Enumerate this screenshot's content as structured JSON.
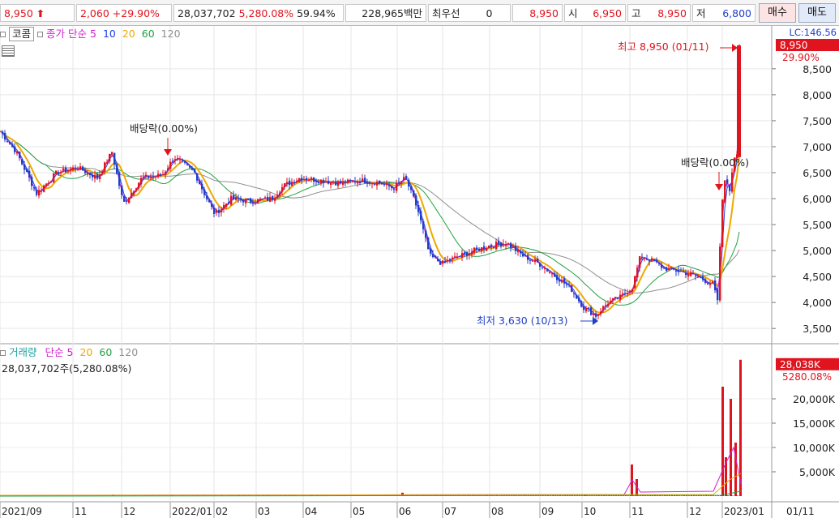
{
  "quote_bar": {
    "price": "8,950",
    "change": "2,060",
    "change_rate": "+29.90%",
    "volume": "28,037,702",
    "volume_rate": "5,280.08%",
    "turnover": "59.94%",
    "trade_value": "228,965백만",
    "best_quote_label": "최우선",
    "best_quote_value": "0",
    "current_price": "8,950",
    "open_label": "시",
    "open_value": "6,950",
    "high_label": "고",
    "high_value": "8,950",
    "low_label": "저",
    "low_value": "6,800",
    "buy_label": "매수",
    "sell_label": "매도",
    "colors": {
      "up": "#e0141e",
      "down": "#1f3fc8"
    }
  },
  "price_legend": {
    "name": "코콤",
    "indicator": "종가 단순",
    "periods": [
      "5",
      "10",
      "20",
      "60",
      "120"
    ],
    "colors": [
      "#d020d0",
      "#2040e0",
      "#f0a800",
      "#20a040",
      "#909090"
    ]
  },
  "volume_legend": {
    "name": "거래량",
    "indicator": "단순",
    "periods": [
      "5",
      "20",
      "60",
      "120"
    ],
    "colors": [
      "#d020d0",
      "#f0a800",
      "#20a040",
      "#909090"
    ],
    "summary": "28,037,702주(5,280.08%)"
  },
  "chart_data": {
    "type": "candlestick",
    "title": "코콤",
    "x_tick_labels": [
      "2021/09",
      "11",
      "12",
      "2022/01",
      "02",
      "03",
      "04",
      "05",
      "06",
      "07",
      "08",
      "09",
      "10",
      "11",
      "12",
      "2023/01",
      "01/11"
    ],
    "price_axis": {
      "tick_labels": [
        "3,500",
        "4,000",
        "4,500",
        "5,000",
        "5,500",
        "6,000",
        "6,500",
        "7,000",
        "7,500",
        "8,000",
        "8,500"
      ],
      "ylim": [
        3300,
        9200
      ],
      "top_label": "LC:146.56",
      "current_label": "8,950",
      "current_rate_label": "29.90%"
    },
    "volume_axis": {
      "tick_labels": [
        "5,000K",
        "10,000K",
        "15,000K",
        "20,000K"
      ],
      "ylim": [
        0,
        30000
      ],
      "current_label": "28,038K",
      "current_rate_label": "5280.08%"
    },
    "annotations": {
      "high": "최고 8,950 (01/11)",
      "low": "최저 3,630 (10/13)",
      "dividend_1": "배당락(0.00%)",
      "dividend_2": "배당락(0.00%)"
    },
    "close_series_keypoints": [
      [
        0,
        7300
      ],
      [
        20,
        6900
      ],
      [
        45,
        6100
      ],
      [
        70,
        6500
      ],
      [
        95,
        6600
      ],
      [
        120,
        6400
      ],
      [
        138,
        6900
      ],
      [
        152,
        5900
      ],
      [
        175,
        6400
      ],
      [
        200,
        6450
      ],
      [
        215,
        6800
      ],
      [
        240,
        6500
      ],
      [
        255,
        6000
      ],
      [
        265,
        5700
      ],
      [
        285,
        6000
      ],
      [
        310,
        5950
      ],
      [
        335,
        6000
      ],
      [
        350,
        6250
      ],
      [
        370,
        6400
      ],
      [
        395,
        6350
      ],
      [
        420,
        6300
      ],
      [
        445,
        6350
      ],
      [
        470,
        6300
      ],
      [
        485,
        6200
      ],
      [
        500,
        6400
      ],
      [
        515,
        5800
      ],
      [
        530,
        4900
      ],
      [
        545,
        4750
      ],
      [
        560,
        4850
      ],
      [
        585,
        5000
      ],
      [
        605,
        5100
      ],
      [
        625,
        5150
      ],
      [
        645,
        4900
      ],
      [
        665,
        4750
      ],
      [
        690,
        4450
      ],
      [
        705,
        4250
      ],
      [
        720,
        3900
      ],
      [
        735,
        3750
      ],
      [
        750,
        4000
      ],
      [
        765,
        4100
      ],
      [
        780,
        4300
      ],
      [
        790,
        4900
      ],
      [
        805,
        4800
      ],
      [
        820,
        4650
      ],
      [
        840,
        4600
      ],
      [
        860,
        4500
      ],
      [
        880,
        4350
      ],
      [
        885,
        4000
      ],
      [
        890,
        5800
      ],
      [
        895,
        6500
      ],
      [
        900,
        6100
      ],
      [
        905,
        6800
      ],
      [
        910,
        6900
      ],
      [
        914,
        8950
      ]
    ],
    "volume_spikes": [
      [
        138,
        300
      ],
      [
        210,
        200
      ],
      [
        383,
        250
      ],
      [
        495,
        700
      ],
      [
        720,
        300
      ],
      [
        778,
        6500
      ],
      [
        784,
        3500
      ],
      [
        890,
        22500
      ],
      [
        894,
        8000
      ],
      [
        900,
        20000
      ],
      [
        906,
        11000
      ],
      [
        912,
        28038
      ]
    ]
  }
}
